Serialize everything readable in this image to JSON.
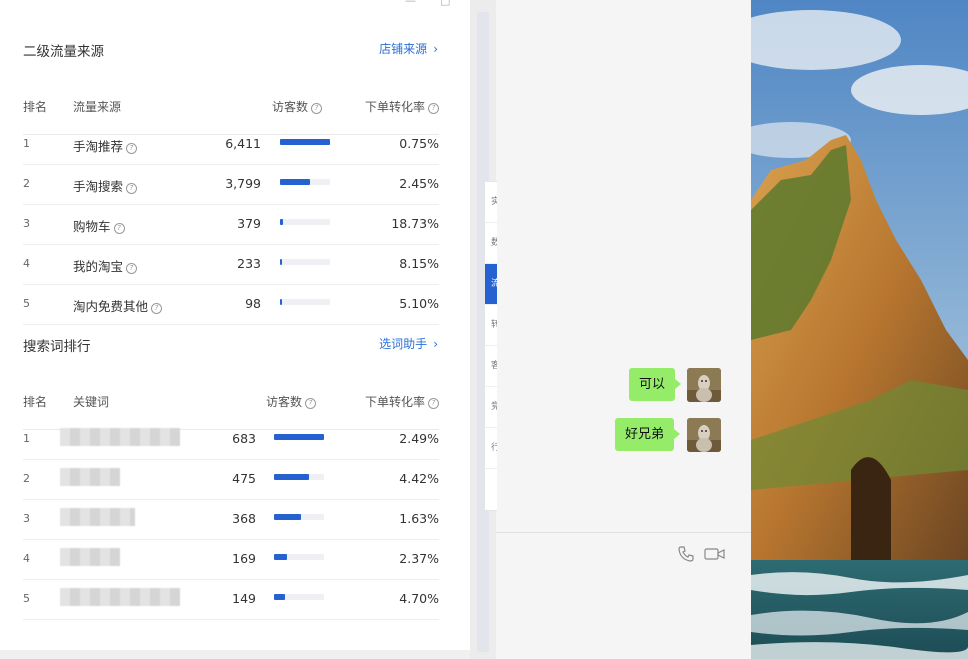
{
  "window_controls": [
    "—",
    "□",
    "✕"
  ],
  "secondary_traffic": {
    "title": "二级流量来源",
    "link_label": "店铺来源",
    "columns": {
      "rank": "排名",
      "source": "流量来源",
      "visitors": "访客数",
      "conversion": "下单转化率"
    },
    "rows": [
      {
        "rank": "1",
        "source": "手淘推荐",
        "visitors": "6,411",
        "conversion": "0.75%",
        "share": 1.0
      },
      {
        "rank": "2",
        "source": "手淘搜索",
        "visitors": "3,799",
        "conversion": "2.45%",
        "share": 0.59
      },
      {
        "rank": "3",
        "source": "购物车",
        "visitors": "379",
        "conversion": "18.73%",
        "share": 0.06
      },
      {
        "rank": "4",
        "source": "我的淘宝",
        "visitors": "233",
        "conversion": "8.15%",
        "share": 0.04
      },
      {
        "rank": "5",
        "source": "淘内免费其他",
        "visitors": "98",
        "conversion": "5.10%",
        "share": 0.02
      }
    ]
  },
  "search_terms": {
    "title": "搜索词排行",
    "link_label": "选词助手",
    "columns": {
      "rank": "排名",
      "keyword": "关键词",
      "visitors": "访客数",
      "conversion": "下单转化率"
    },
    "rows": [
      {
        "rank": "1",
        "visitors": "683",
        "conversion": "2.49%",
        "share": 1.0
      },
      {
        "rank": "2",
        "visitors": "475",
        "conversion": "4.42%",
        "share": 0.7
      },
      {
        "rank": "3",
        "visitors": "368",
        "conversion": "1.63%",
        "share": 0.54
      },
      {
        "rank": "4",
        "visitors": "169",
        "conversion": "2.37%",
        "share": 0.25
      },
      {
        "rank": "5",
        "visitors": "149",
        "conversion": "4.70%",
        "share": 0.22
      }
    ]
  },
  "chat": {
    "messages": [
      "可以",
      "好兄弟"
    ],
    "tools": {
      "call_icon": "phone-icon",
      "video_icon": "video-icon"
    }
  },
  "colors": {
    "accent": "#2661d1",
    "bubble": "#95ec69",
    "link": "#2a6fd6"
  }
}
